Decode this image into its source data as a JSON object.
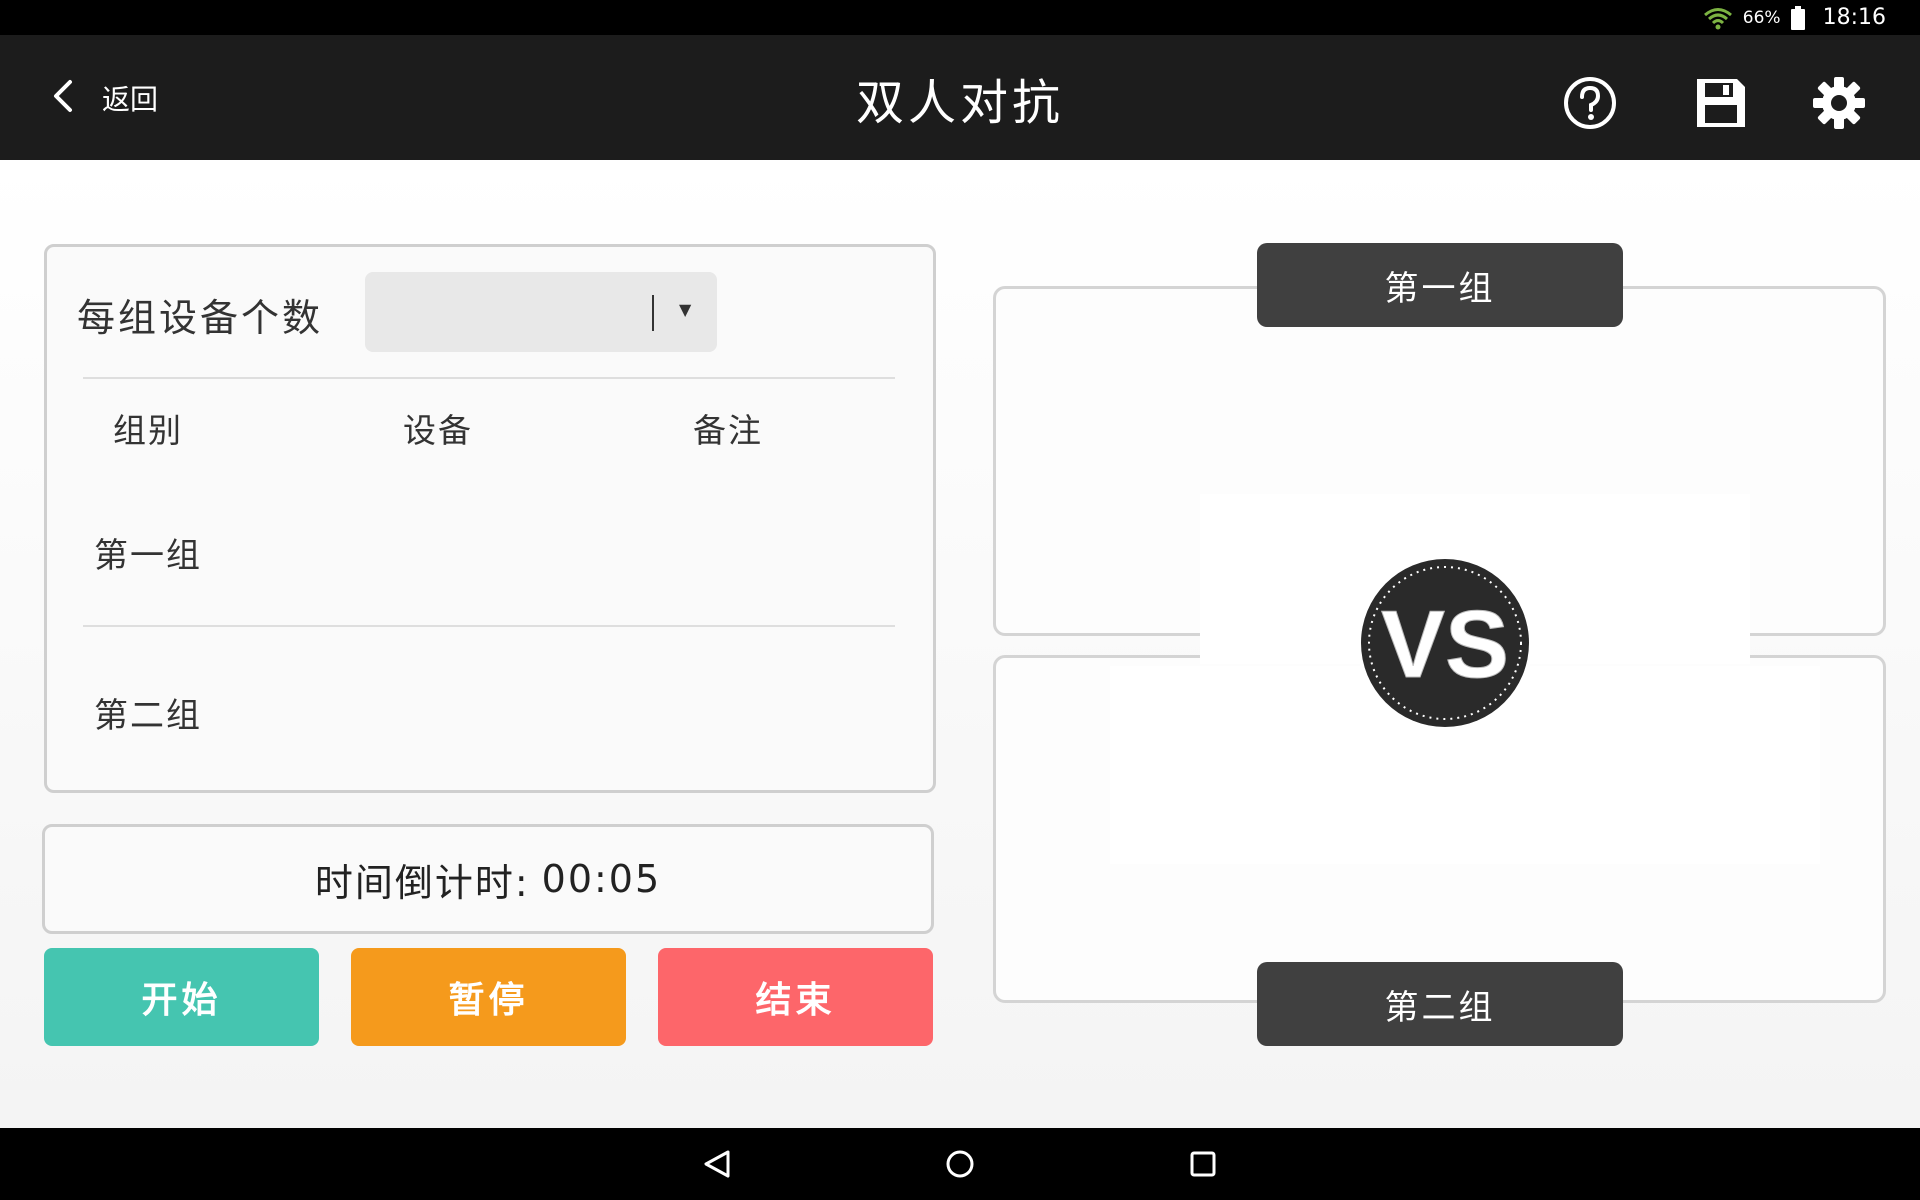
{
  "status_bar": {
    "battery_pct": "66%",
    "time": "18:16",
    "icons": [
      "wifi-icon",
      "battery-icon"
    ]
  },
  "app_bar": {
    "back_label": "返回",
    "title": "双人对抗",
    "icons": [
      "chevron-left-icon",
      "help-circle-icon",
      "save-floppy-icon",
      "gear-icon"
    ]
  },
  "config": {
    "devices_per_group_label": "每组设备个数",
    "devices_per_group_value": "",
    "columns": [
      "组别",
      "设备",
      "备注"
    ],
    "rows": [
      {
        "group": "第一组",
        "device": "",
        "note": ""
      },
      {
        "group": "第二组",
        "device": "",
        "note": ""
      }
    ]
  },
  "timer": {
    "label": "时间倒计时:",
    "value": "00:05"
  },
  "buttons": {
    "start": "开始",
    "pause": "暂停",
    "stop": "结束"
  },
  "vs": {
    "group_one": "第一组",
    "group_two": "第二组",
    "badge": "VS"
  },
  "colors": {
    "start": "#45c5b0",
    "pause": "#f59a1c",
    "stop": "#fd666a",
    "app_bar": "#1c1c1c",
    "group_tab": "#404040"
  },
  "nav_bar": {
    "icons": [
      "nav-back-icon",
      "nav-home-icon",
      "nav-recents-icon"
    ]
  }
}
